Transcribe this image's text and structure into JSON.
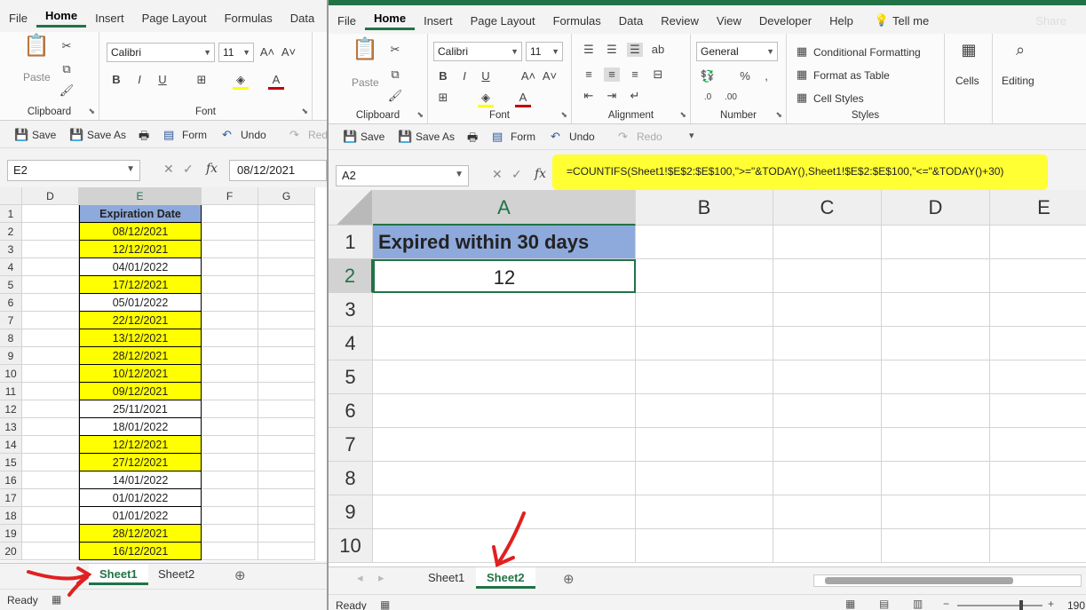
{
  "left_window": {
    "menu": [
      "File",
      "Home",
      "Insert",
      "Page Layout",
      "Formulas",
      "Data"
    ],
    "ribbon": {
      "paste_label": "Paste",
      "clipboard_label": "Clipboard",
      "font_name": "Calibri",
      "font_size": "11",
      "font_label": "Font"
    },
    "qat": {
      "save": "Save",
      "save_as": "Save As",
      "form": "Form",
      "undo": "Undo",
      "redo": "Red"
    },
    "name_box": "E2",
    "formula": "08/12/2021",
    "columns": [
      "D",
      "E",
      "F",
      "G"
    ],
    "header_cell": "Expiration Date",
    "dates": [
      {
        "v": "08/12/2021",
        "hl": true
      },
      {
        "v": "12/12/2021",
        "hl": true
      },
      {
        "v": "04/01/2022",
        "hl": false
      },
      {
        "v": "17/12/2021",
        "hl": true
      },
      {
        "v": "05/01/2022",
        "hl": false
      },
      {
        "v": "22/12/2021",
        "hl": true
      },
      {
        "v": "13/12/2021",
        "hl": true
      },
      {
        "v": "28/12/2021",
        "hl": true
      },
      {
        "v": "10/12/2021",
        "hl": true
      },
      {
        "v": "09/12/2021",
        "hl": true
      },
      {
        "v": "25/11/2021",
        "hl": false
      },
      {
        "v": "18/01/2022",
        "hl": false
      },
      {
        "v": "12/12/2021",
        "hl": true
      },
      {
        "v": "27/12/2021",
        "hl": true
      },
      {
        "v": "14/01/2022",
        "hl": false
      },
      {
        "v": "01/01/2022",
        "hl": false
      },
      {
        "v": "01/01/2022",
        "hl": false
      },
      {
        "v": "28/12/2021",
        "hl": true
      },
      {
        "v": "16/12/2021",
        "hl": true
      }
    ],
    "row_numbers": [
      "1",
      "2",
      "3",
      "4",
      "5",
      "6",
      "7",
      "8",
      "9",
      "10",
      "11",
      "12",
      "13",
      "14",
      "15",
      "16",
      "17",
      "18",
      "19",
      "20"
    ],
    "tabs": [
      "Sheet1",
      "Sheet2"
    ],
    "status": "Ready"
  },
  "right_window": {
    "menu": [
      "File",
      "Home",
      "Insert",
      "Page Layout",
      "Formulas",
      "Data",
      "Review",
      "View",
      "Developer",
      "Help"
    ],
    "tell_me": "Tell me",
    "share": "Share",
    "ribbon": {
      "paste_label": "Paste",
      "clipboard_label": "Clipboard",
      "font_name": "Calibri",
      "font_size": "11",
      "font_label": "Font",
      "alignment_label": "Alignment",
      "number_format": "General",
      "number_label": "Number",
      "conditional_formatting": "Conditional Formatting",
      "format_as_table": "Format as Table",
      "cell_styles": "Cell Styles",
      "styles_label": "Styles",
      "cells_label": "Cells",
      "editing_label": "Editing"
    },
    "qat": {
      "save": "Save",
      "save_as": "Save As",
      "form": "Form",
      "undo": "Undo",
      "redo": "Redo"
    },
    "name_box": "A2",
    "formula": "=COUNTIFS(Sheet1!$E$2:$E$100,\">=\"&TODAY(),Sheet1!$E$2:$E$100,\"<=\"&TODAY()+30)",
    "columns": [
      "A",
      "B",
      "C",
      "D",
      "E"
    ],
    "row_numbers": [
      "1",
      "2",
      "3",
      "4",
      "5",
      "6",
      "7",
      "8",
      "9",
      "10"
    ],
    "a1": "Expired within 30 days",
    "a2": "12",
    "tabs": [
      "Sheet1",
      "Sheet2"
    ],
    "status": "Ready",
    "zoom": "190"
  },
  "colors": {
    "excel_green": "#217346",
    "highlight": "#ffff00",
    "header_fill": "#8ea9db",
    "annot": "#e02020"
  }
}
